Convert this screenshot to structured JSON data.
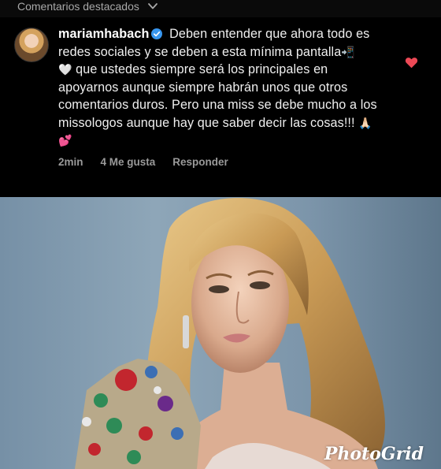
{
  "header": {
    "section_title": "Comentarios destacados"
  },
  "comment": {
    "username": "mariamhabach",
    "text_line1": " Deben entender que ahora todo es redes sociales y se deben a esta mínima pantalla",
    "text_line2": " que ustedes siempre será los principales en apoyarnos aunque siempre habrán unos que otros comentarios  duros. Pero una miss se debe mucho a los missologos aunque hay que saber decir las cosas!!! ",
    "emoji_phone": "📲",
    "emoji_heart": "🤍",
    "emoji_end": "🙏🏻💕",
    "time": "2min",
    "likes": "4 Me gusta",
    "reply_label": "Responder"
  },
  "colors": {
    "background": "#000000",
    "like_heart": "#ed4956",
    "verified": "#3897f0"
  },
  "photo": {
    "watermark": "PhotoGrid"
  }
}
